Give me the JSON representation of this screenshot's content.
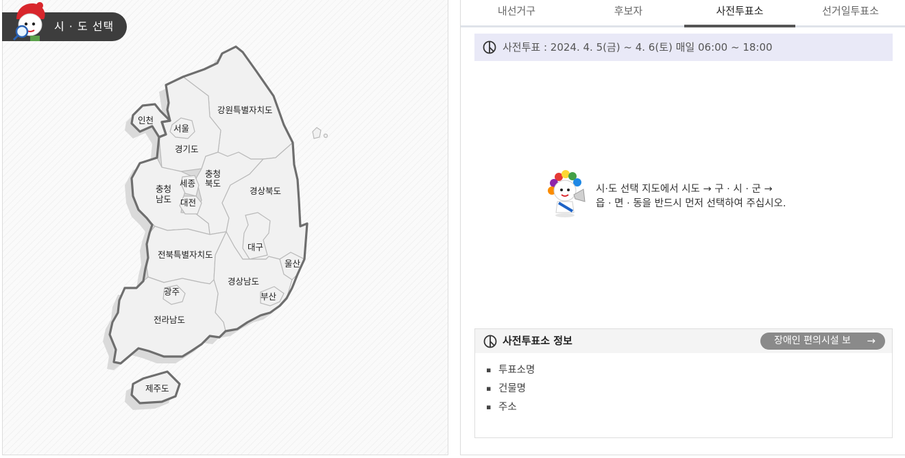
{
  "map_panel": {
    "badge_label": "시 · 도 선택",
    "regions": [
      {
        "id": "incheon",
        "label": "인천"
      },
      {
        "id": "seoul",
        "label": "서울"
      },
      {
        "id": "gangwon",
        "label": "강원특별자치도"
      },
      {
        "id": "gyeonggi",
        "label": "경기도"
      },
      {
        "id": "chungbuk",
        "label": "충청\n북도"
      },
      {
        "id": "chungnam",
        "label": "충청\n남도"
      },
      {
        "id": "sejong",
        "label": "세종"
      },
      {
        "id": "daejeon",
        "label": "대전"
      },
      {
        "id": "gyeongbuk",
        "label": "경상북도"
      },
      {
        "id": "daegu",
        "label": "대구"
      },
      {
        "id": "jeonbuk",
        "label": "전북특별자치도"
      },
      {
        "id": "ulsan",
        "label": "울산"
      },
      {
        "id": "gwangju",
        "label": "광주"
      },
      {
        "id": "gyeongnam",
        "label": "경상남도"
      },
      {
        "id": "busan",
        "label": "부산"
      },
      {
        "id": "jeonnam",
        "label": "전라남도"
      },
      {
        "id": "jeju",
        "label": "제주도"
      }
    ]
  },
  "tabs": [
    {
      "label": "내선거구",
      "active": false
    },
    {
      "label": "후보자",
      "active": false
    },
    {
      "label": "사전투표소",
      "active": true
    },
    {
      "label": "선거일투표소",
      "active": false
    }
  ],
  "period": {
    "icon": "ballot-icon",
    "text": "사전투표 : 2024. 4. 5(금) ~ 4. 6(토) 매일 06:00 ~ 18:00"
  },
  "notice": {
    "line1": "시·도 선택 지도에서 시도 → 구 · 시 · 군 →",
    "line2": "읍 · 면 · 동을 반드시 먼저 선택하여 주십시오."
  },
  "info": {
    "title": "사전투표소 정보",
    "facility_button": "장애인 편의시설 보",
    "facility_arrow": "→",
    "items": [
      "투표소명",
      "건물명",
      "주소"
    ]
  },
  "colors": {
    "badge_bg": "#3d3d3d",
    "period_bg": "#e9e9f7",
    "region_fill": "#f1f1f1",
    "outline": "#6e6e6e",
    "button_bg": "#8a8a8a"
  }
}
